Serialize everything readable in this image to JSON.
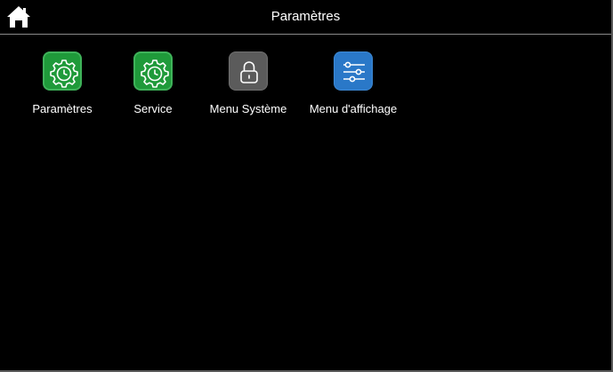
{
  "header": {
    "title": "Paramètres",
    "home_icon": "home-icon"
  },
  "tiles": [
    {
      "label": "Paramètres",
      "icon": "gear-clock-icon",
      "color": "#1f9a3a"
    },
    {
      "label": "Service",
      "icon": "gear-clock-icon",
      "color": "#1f9a3a"
    },
    {
      "label": "Menu Système",
      "icon": "lock-icon",
      "color": "#5b5b5b"
    },
    {
      "label": "Menu d'affichage",
      "icon": "sliders-icon",
      "color": "#2a78c8"
    }
  ]
}
